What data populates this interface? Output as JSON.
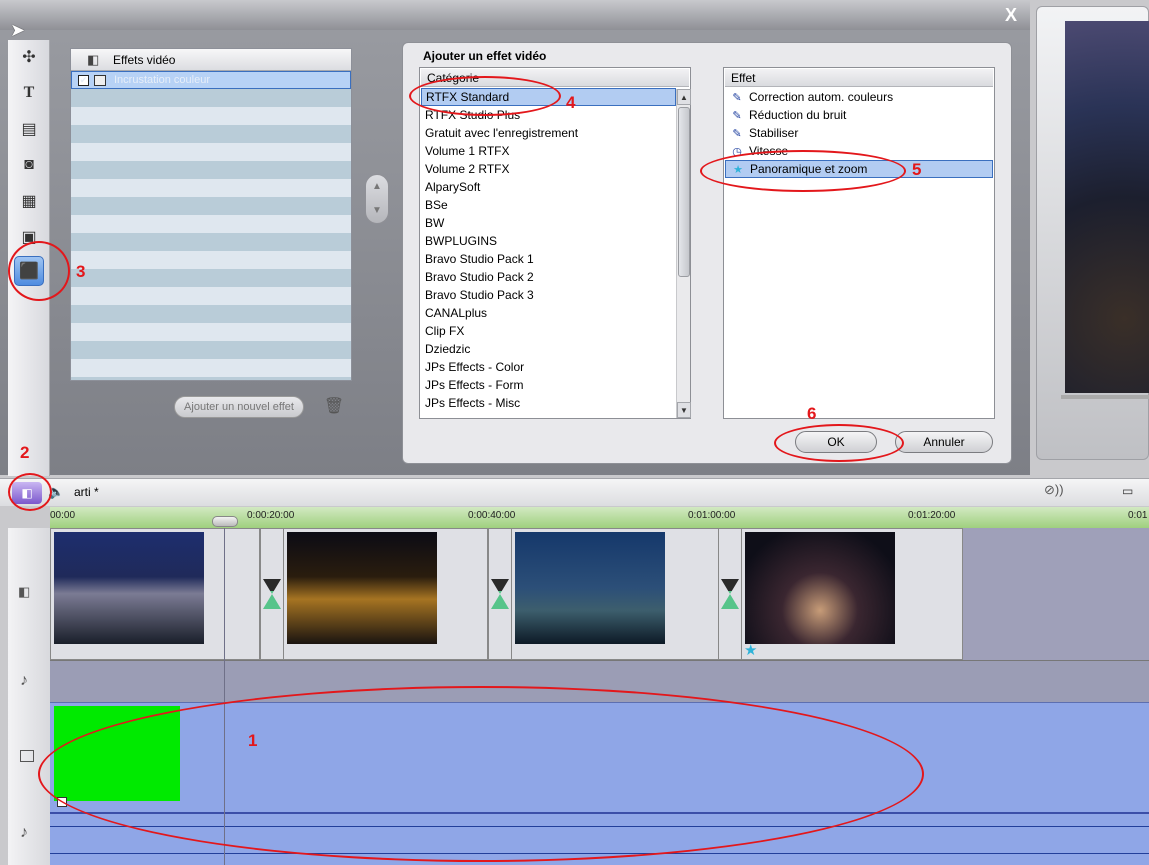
{
  "effects_panel": {
    "header": "Effets vidéo",
    "item_label": "Incrustation couleur",
    "add_button": "Ajouter un nouvel effet"
  },
  "dialog": {
    "title": "Ajouter un effet vidéo",
    "category_header": "Catégorie",
    "effect_header": "Effet",
    "categories": [
      "RTFX Standard",
      "RTFX Studio Plus",
      "Gratuit avec l'enregistrement",
      "Volume 1 RTFX",
      "Volume 2 RTFX",
      "AlparySoft",
      "BSe",
      "BW",
      "BWPLUGINS",
      "Bravo Studio Pack 1",
      "Bravo Studio Pack 2",
      "Bravo Studio Pack 3",
      "CANALplus",
      "Clip FX",
      "Dziedzic",
      "JPs Effects - Color",
      "JPs Effects - Form",
      "JPs Effects - Misc"
    ],
    "effects": [
      "Correction autom. couleurs",
      "Réduction du bruit",
      "Stabiliser",
      "Vitesse",
      "Panoramique et zoom"
    ],
    "ok_label": "OK",
    "cancel_label": "Annuler"
  },
  "window": {
    "close_label": "X"
  },
  "timeline": {
    "project_name": "arti *",
    "ruler_labels": [
      "00:00",
      "0:00:20:00",
      "0:00:40:00",
      "0:01:00:00",
      "0:01:20:00",
      "0:01"
    ]
  },
  "annotations": [
    "1",
    "2",
    "3",
    "4",
    "5",
    "6"
  ],
  "colors": {
    "annotation": "#e3171b",
    "selection": "#b2ccf2",
    "overlay_clip": "#00ea00",
    "overlay_track": "#8fa6e7"
  }
}
